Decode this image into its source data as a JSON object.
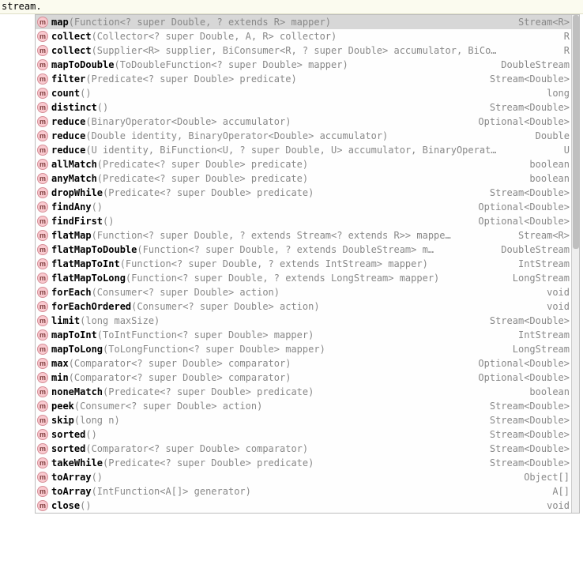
{
  "editor": {
    "text": "stream."
  },
  "completion": {
    "selected_index": 0,
    "items": [
      {
        "name": "map",
        "params": "(Function<? super Double, ? extends R> mapper)",
        "ret": "Stream<R>"
      },
      {
        "name": "collect",
        "params": "(Collector<? super Double, A, R> collector)",
        "ret": "R"
      },
      {
        "name": "collect",
        "params": "(Supplier<R> supplier, BiConsumer<R, ? super Double> accumulator, BiCo…",
        "ret": "R"
      },
      {
        "name": "mapToDouble",
        "params": "(ToDoubleFunction<? super Double> mapper)",
        "ret": "DoubleStream"
      },
      {
        "name": "filter",
        "params": "(Predicate<? super Double> predicate)",
        "ret": "Stream<Double>"
      },
      {
        "name": "count",
        "params": "()",
        "ret": "long"
      },
      {
        "name": "distinct",
        "params": "()",
        "ret": "Stream<Double>"
      },
      {
        "name": "reduce",
        "params": "(BinaryOperator<Double> accumulator)",
        "ret": "Optional<Double>"
      },
      {
        "name": "reduce",
        "params": "(Double identity, BinaryOperator<Double> accumulator)",
        "ret": "Double"
      },
      {
        "name": "reduce",
        "params": "(U identity, BiFunction<U, ? super Double, U> accumulator, BinaryOperat…",
        "ret": "U"
      },
      {
        "name": "allMatch",
        "params": "(Predicate<? super Double> predicate)",
        "ret": "boolean"
      },
      {
        "name": "anyMatch",
        "params": "(Predicate<? super Double> predicate)",
        "ret": "boolean"
      },
      {
        "name": "dropWhile",
        "params": "(Predicate<? super Double> predicate)",
        "ret": "Stream<Double>"
      },
      {
        "name": "findAny",
        "params": "()",
        "ret": "Optional<Double>"
      },
      {
        "name": "findFirst",
        "params": "()",
        "ret": "Optional<Double>"
      },
      {
        "name": "flatMap",
        "params": "(Function<? super Double, ? extends Stream<? extends R>> mappe…",
        "ret": "Stream<R>"
      },
      {
        "name": "flatMapToDouble",
        "params": "(Function<? super Double, ? extends DoubleStream> m…",
        "ret": "DoubleStream"
      },
      {
        "name": "flatMapToInt",
        "params": "(Function<? super Double, ? extends IntStream> mapper)",
        "ret": "IntStream"
      },
      {
        "name": "flatMapToLong",
        "params": "(Function<? super Double, ? extends LongStream> mapper)",
        "ret": "LongStream"
      },
      {
        "name": "forEach",
        "params": "(Consumer<? super Double> action)",
        "ret": "void"
      },
      {
        "name": "forEachOrdered",
        "params": "(Consumer<? super Double> action)",
        "ret": "void"
      },
      {
        "name": "limit",
        "params": "(long maxSize)",
        "ret": "Stream<Double>"
      },
      {
        "name": "mapToInt",
        "params": "(ToIntFunction<? super Double> mapper)",
        "ret": "IntStream"
      },
      {
        "name": "mapToLong",
        "params": "(ToLongFunction<? super Double> mapper)",
        "ret": "LongStream"
      },
      {
        "name": "max",
        "params": "(Comparator<? super Double> comparator)",
        "ret": "Optional<Double>"
      },
      {
        "name": "min",
        "params": "(Comparator<? super Double> comparator)",
        "ret": "Optional<Double>"
      },
      {
        "name": "noneMatch",
        "params": "(Predicate<? super Double> predicate)",
        "ret": "boolean"
      },
      {
        "name": "peek",
        "params": "(Consumer<? super Double> action)",
        "ret": "Stream<Double>"
      },
      {
        "name": "skip",
        "params": "(long n)",
        "ret": "Stream<Double>"
      },
      {
        "name": "sorted",
        "params": "()",
        "ret": "Stream<Double>"
      },
      {
        "name": "sorted",
        "params": "(Comparator<? super Double> comparator)",
        "ret": "Stream<Double>"
      },
      {
        "name": "takeWhile",
        "params": "(Predicate<? super Double> predicate)",
        "ret": "Stream<Double>"
      },
      {
        "name": "toArray",
        "params": "()",
        "ret": "Object[]"
      },
      {
        "name": "toArray",
        "params": "(IntFunction<A[]> generator)",
        "ret": "A[]"
      },
      {
        "name": "close",
        "params": "()",
        "ret": "void"
      }
    ]
  },
  "icon_glyph": "m"
}
